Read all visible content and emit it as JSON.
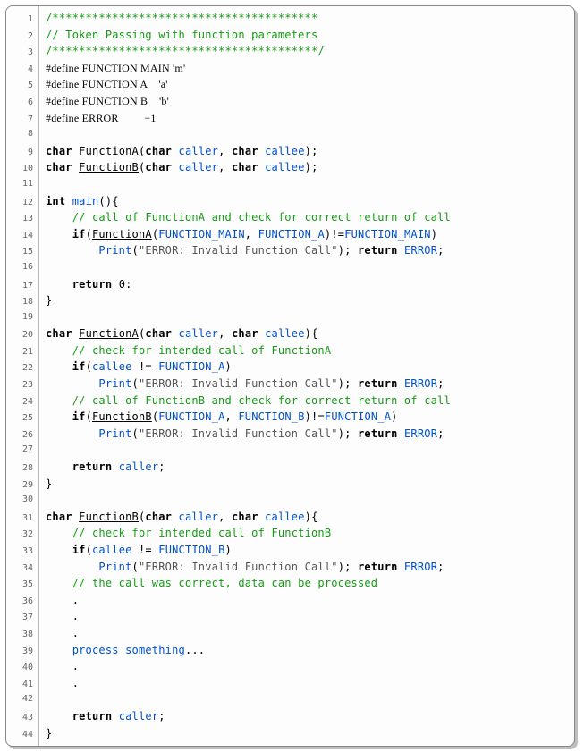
{
  "lines": [
    {
      "n": "1",
      "html": "<span class='green'>/****************************************</span>"
    },
    {
      "n": "2",
      "html": "<span class='green'>// Token Passing with function parameters</span>"
    },
    {
      "n": "3",
      "html": "<span class='green'>/****************************************/</span>"
    },
    {
      "n": "4",
      "html": "<span class='def black'>#define FUNCTION MAIN 'm'</span>",
      "serif": true
    },
    {
      "n": "5",
      "html": "<span class='def black'>#define FUNCTION A    'a'</span>",
      "serif": true
    },
    {
      "n": "6",
      "html": "<span class='def black'>#define FUNCTION B    'b'</span>",
      "serif": true
    },
    {
      "n": "7",
      "html": "<span class='def black'>#define ERROR         &#8722;1</span>",
      "serif": true
    },
    {
      "n": "8",
      "html": ""
    },
    {
      "n": "9",
      "html": "<span class='kw'>char</span> <span class='funcU'>FunctionA</span>(<span class='kw'>char</span> <span class='blue'>caller</span>, <span class='kw'>char</span> <span class='blue'>callee</span>);"
    },
    {
      "n": "10",
      "html": "<span class='kw'>char</span> <span class='funcU'>FunctionB</span>(<span class='kw'>char</span> <span class='blue'>caller</span>, <span class='kw'>char</span> <span class='blue'>callee</span>);"
    },
    {
      "n": "11",
      "html": ""
    },
    {
      "n": "12",
      "html": "<span class='kw'>int</span> <span class='blue'>main</span>(){"
    },
    {
      "n": "13",
      "html": "    <span class='green'>// call of FunctionA and check for correct return of call</span>"
    },
    {
      "n": "14",
      "html": "    <span class='kw'>if</span>(<span class='funcU'>FunctionA</span>(<span class='blue'>FUNCTION_MAIN</span>, <span class='blue'>FUNCTION_A</span>)!=<span class='blue'>FUNCTION_MAIN</span>)"
    },
    {
      "n": "15",
      "html": "        <span class='blue'>Print</span>(<span class='gray'>\"ERROR: Invalid Function Call\"</span>); <span class='kw'>return</span> <span class='blue'>ERROR</span>;"
    },
    {
      "n": "16",
      "html": ""
    },
    {
      "n": "17",
      "html": "    <span class='kw'>return</span> 0:"
    },
    {
      "n": "18",
      "html": "}"
    },
    {
      "n": "19",
      "html": ""
    },
    {
      "n": "20",
      "html": "<span class='kw'>char</span> <span class='funcU'>FunctionA</span>(<span class='kw'>char</span> <span class='blue'>caller</span>, <span class='kw'>char</span> <span class='blue'>callee</span>){"
    },
    {
      "n": "21",
      "html": "    <span class='green'>// check for intended call of FunctionA</span>"
    },
    {
      "n": "22",
      "html": "    <span class='kw'>if</span>(<span class='blue'>callee</span> != <span class='blue'>FUNCTION_A</span>)"
    },
    {
      "n": "23",
      "html": "        <span class='blue'>Print</span>(<span class='gray'>\"ERROR: Invalid Function Call\"</span>); <span class='kw'>return</span> <span class='blue'>ERROR</span>;"
    },
    {
      "n": "24",
      "html": "    <span class='green'>// call of FunctionB and check for correct return of call</span>"
    },
    {
      "n": "25",
      "html": "    <span class='kw'>if</span>(<span class='funcU'>FunctionB</span>(<span class='blue'>FUNCTION_A</span>, <span class='blue'>FUNCTION_B</span>)!=<span class='blue'>FUNCTION_A</span>)"
    },
    {
      "n": "26",
      "html": "        <span class='blue'>Print</span>(<span class='gray'>\"ERROR: Invalid Function Call\"</span>); <span class='kw'>return</span> <span class='blue'>ERROR</span>;"
    },
    {
      "n": "27",
      "html": ""
    },
    {
      "n": "28",
      "html": "    <span class='kw'>return</span> <span class='blue'>caller</span>;"
    },
    {
      "n": "29",
      "html": "}"
    },
    {
      "n": "30",
      "html": ""
    },
    {
      "n": "31",
      "html": "<span class='kw'>char</span> <span class='funcU'>FunctionB</span>(<span class='kw'>char</span> <span class='blue'>caller</span>, <span class='kw'>char</span> <span class='blue'>callee</span>){"
    },
    {
      "n": "32",
      "html": "    <span class='green'>// check for intended call of FunctionB</span>"
    },
    {
      "n": "33",
      "html": "    <span class='kw'>if</span>(<span class='blue'>callee</span> != <span class='blue'>FUNCTION_B</span>)"
    },
    {
      "n": "34",
      "html": "        <span class='blue'>Print</span>(<span class='gray'>\"ERROR: Invalid Function Call\"</span>); <span class='kw'>return</span> <span class='blue'>ERROR</span>;"
    },
    {
      "n": "35",
      "html": "    <span class='green'>// the call was correct, data can be processed</span>"
    },
    {
      "n": "36",
      "html": "    ."
    },
    {
      "n": "37",
      "html": "    ."
    },
    {
      "n": "38",
      "html": "    ."
    },
    {
      "n": "39",
      "html": "    <span class='blue'>process</span> <span class='blue'>something</span>..."
    },
    {
      "n": "40",
      "html": "    ."
    },
    {
      "n": "41",
      "html": "    ."
    },
    {
      "n": "42",
      "html": ""
    },
    {
      "n": "43",
      "html": "    <span class='kw'>return</span> <span class='blue'>caller</span>;"
    },
    {
      "n": "44",
      "html": "}"
    }
  ]
}
